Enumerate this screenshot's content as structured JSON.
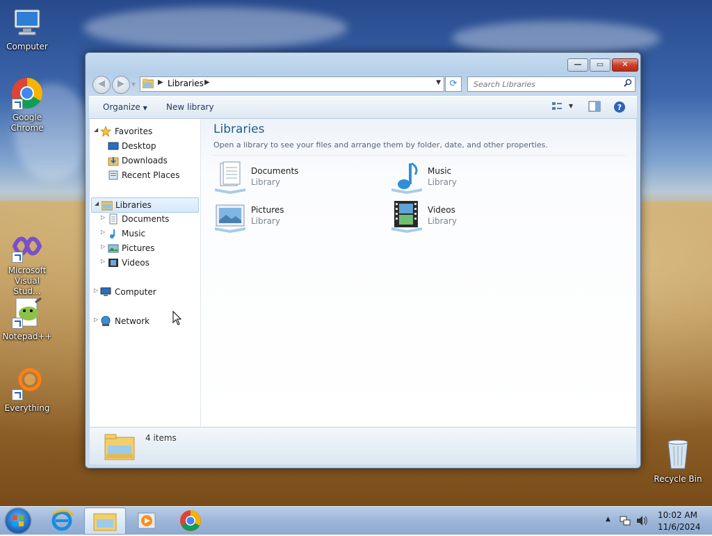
{
  "desktop": {
    "icons": [
      {
        "label": "Computer",
        "icon": "computer-icon"
      },
      {
        "label": "Google Chrome",
        "icon": "chrome-icon"
      },
      {
        "label": "Microsoft Visual Stud...",
        "icon": "visual-studio-icon"
      },
      {
        "label": "Notepad++",
        "icon": "notepadpp-icon"
      },
      {
        "label": "Everything",
        "icon": "everything-icon"
      },
      {
        "label": "Recycle Bin",
        "icon": "recycle-bin-icon"
      }
    ]
  },
  "window": {
    "caption_buttons": {
      "minimize": "minimize-icon",
      "maximize": "maximize-icon",
      "close": "close-icon"
    },
    "address": {
      "crumb": "Libraries"
    },
    "search": {
      "placeholder": "Search Libraries"
    },
    "toolbar": {
      "organize": "Organize",
      "new_library": "New library"
    },
    "nav": {
      "favorites": "Favorites",
      "favorites_items": [
        "Desktop",
        "Downloads",
        "Recent Places"
      ],
      "libraries": "Libraries",
      "libraries_items": [
        "Documents",
        "Music",
        "Pictures",
        "Videos"
      ],
      "computer": "Computer",
      "network": "Network"
    },
    "main": {
      "title": "Libraries",
      "subtitle": "Open a library to see your files and arrange them by folder, date, and other properties.",
      "libraries": [
        {
          "name": "Documents",
          "type": "Library",
          "icon": "documents-library-icon"
        },
        {
          "name": "Music",
          "type": "Library",
          "icon": "music-library-icon"
        },
        {
          "name": "Pictures",
          "type": "Library",
          "icon": "pictures-library-icon"
        },
        {
          "name": "Videos",
          "type": "Library",
          "icon": "videos-library-icon"
        }
      ]
    },
    "details": {
      "count": "4 items"
    }
  },
  "taskbar": {
    "items": [
      "start-icon",
      "internet-explorer-icon",
      "file-explorer-icon",
      "media-player-icon",
      "chrome-icon"
    ],
    "clock": {
      "time": "10:02 AM",
      "date": "11/6/2024"
    }
  },
  "colors": {
    "accent": "#1e5d8f",
    "selection": "#d5e8fb",
    "taskbar": "#9fb8da"
  }
}
